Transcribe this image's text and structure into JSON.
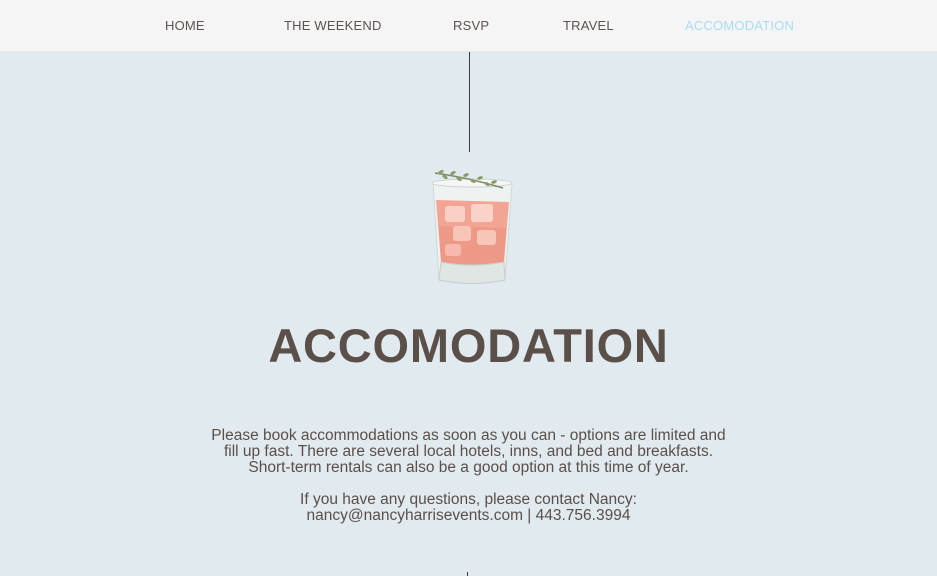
{
  "nav": {
    "items": [
      {
        "label": "HOME",
        "active": false
      },
      {
        "label": "THE WEEKEND",
        "active": false
      },
      {
        "label": "RSVP",
        "active": false
      },
      {
        "label": "TRAVEL",
        "active": false
      },
      {
        "label": "ACCOMODATION",
        "active": true
      }
    ]
  },
  "colors": {
    "background": "#e1eaef",
    "nav_background": "#f5f5f5",
    "text": "#5a4d47",
    "nav_active": "#a9dcf3"
  },
  "hero": {
    "illustration_icon": "cocktail-glass-icon"
  },
  "page": {
    "title": "ACCOMODATION",
    "paragraph_lines": [
      "Please book accommodations as soon as you can - options are limited and",
      "fill up fast. There are several local hotels, inns, and bed and breakfasts.",
      "Short-term rentals can also be a good option at this time of year."
    ],
    "contact_line": "If you have any questions, please contact Nancy:",
    "contact_details": "nancy@nancyharrisevents.com | 443.756.3994"
  }
}
